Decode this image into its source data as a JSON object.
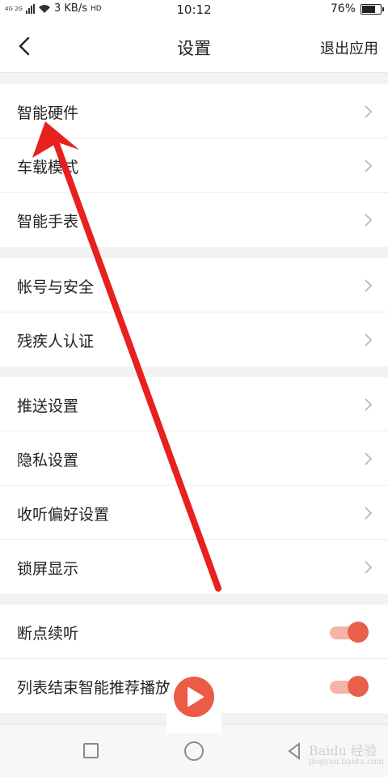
{
  "status_bar": {
    "network_label": "4G 2G",
    "speed": "3 KB/s",
    "call_label": "HD",
    "time": "10:12",
    "battery": "76%",
    "battery_level": 0.76
  },
  "header": {
    "title": "设置",
    "exit_label": "退出应用"
  },
  "groups": [
    {
      "items": [
        "智能硬件",
        "车载模式",
        "智能手表"
      ]
    },
    {
      "items": [
        "帐号与安全",
        "残疾人认证"
      ]
    },
    {
      "items": [
        "推送设置",
        "隐私设置",
        "收听偏好设置",
        "锁屏显示"
      ]
    }
  ],
  "toggles": [
    {
      "label": "断点续听",
      "on": true
    },
    {
      "label": "列表结束智能推荐播放",
      "on": true
    }
  ],
  "watermark": {
    "brand": "Baidu 经验",
    "url": "jingyan.baidu.com"
  },
  "colors": {
    "accent": "#ec5b44",
    "annotation": "#e8201e",
    "toggle_track": "#f5b4a7"
  }
}
